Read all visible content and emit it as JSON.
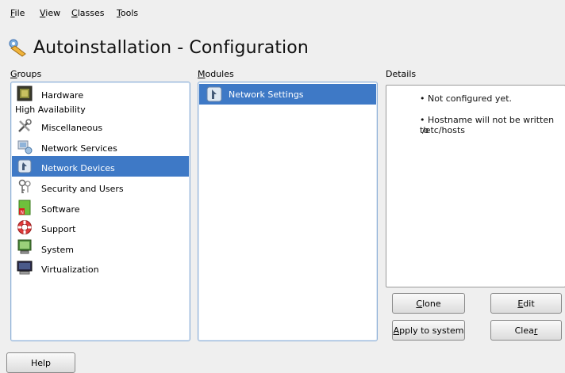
{
  "menu": [
    {
      "label": "File",
      "mnemonic": "F",
      "rest": "ile"
    },
    {
      "label": "View",
      "mnemonic": "V",
      "rest": "iew"
    },
    {
      "label": "Classes",
      "mnemonic": "C",
      "rest": "lasses"
    },
    {
      "label": "Tools",
      "mnemonic": "T",
      "rest": "ools"
    }
  ],
  "title": "Autoinstallation - Configuration",
  "labels": {
    "groups": {
      "mnemonic": "G",
      "rest": "roups"
    },
    "modules": {
      "mnemonic": "M",
      "rest": "odules"
    },
    "details": "Details"
  },
  "groups": [
    {
      "label": "Hardware",
      "icon": "hardware-icon"
    },
    {
      "label": "High Availability",
      "icon": "none",
      "header": true
    },
    {
      "label": "Miscellaneous",
      "icon": "tools-icon"
    },
    {
      "label": "Network Services",
      "icon": "network-services-icon"
    },
    {
      "label": "Network Devices",
      "icon": "network-devices-icon",
      "selected": true
    },
    {
      "label": "Security and Users",
      "icon": "keys-icon"
    },
    {
      "label": "Software",
      "icon": "software-icon"
    },
    {
      "label": "Support",
      "icon": "lifebuoy-icon"
    },
    {
      "label": "System",
      "icon": "system-icon"
    },
    {
      "label": "Virtualization",
      "icon": "monitor-icon"
    }
  ],
  "modules": [
    {
      "label": "Network Settings",
      "icon": "network-settings-icon",
      "selected": true
    }
  ],
  "details": {
    "line1": "• Not configured yet.",
    "line2a": "• Hostname will not be written to",
    "line2b": "/etc/hosts"
  },
  "buttons": {
    "clone": {
      "mnemonic": "C",
      "rest": "lone"
    },
    "edit": {
      "mnemonic": "E",
      "rest": "dit"
    },
    "apply": {
      "mnemonic": "A",
      "rest": "pply to system"
    },
    "clear": {
      "pre": "Clea",
      "mnemonic": "r"
    },
    "help": "Help"
  },
  "colors": {
    "selection": "#3e79c6",
    "panel_border": "#8fb1d8",
    "background": "#efefef"
  }
}
